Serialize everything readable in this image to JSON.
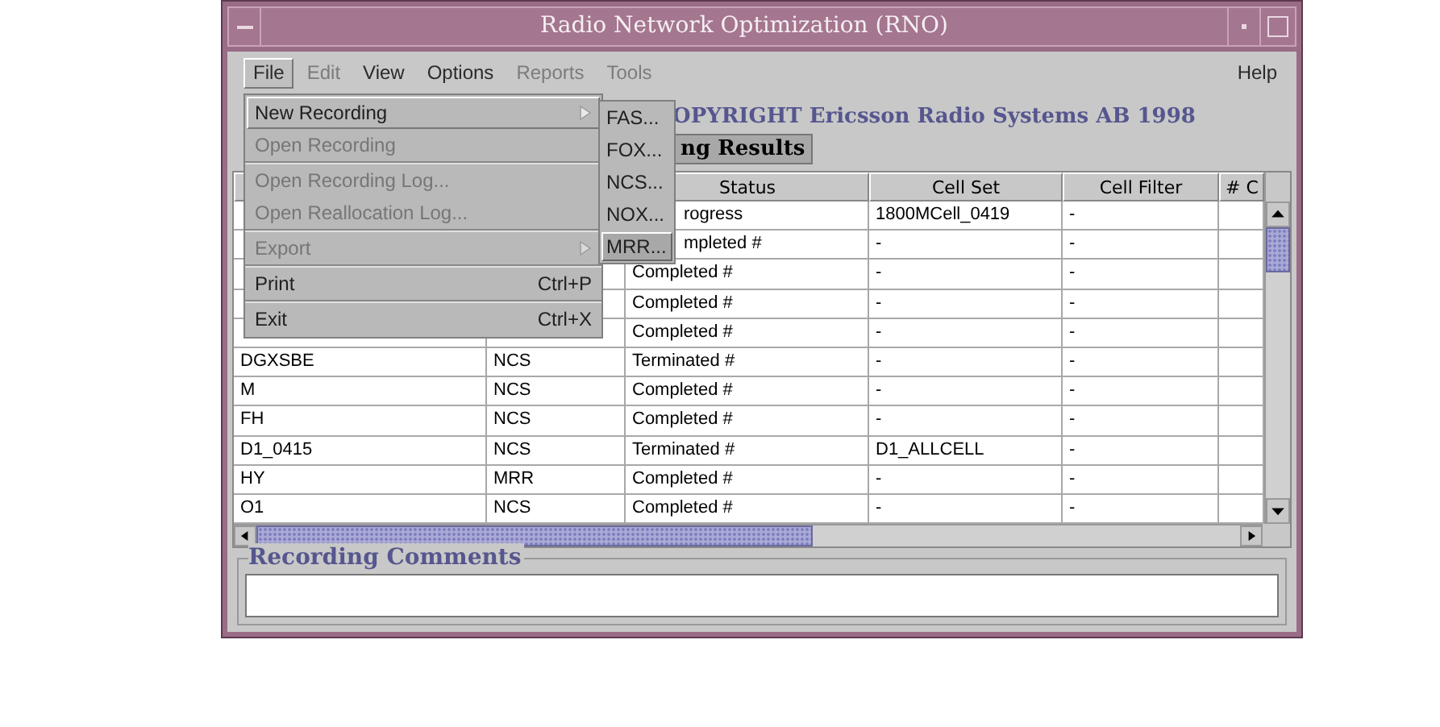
{
  "window": {
    "title": "Radio Network Optimization (RNO)"
  },
  "menubar": [
    {
      "label": "File",
      "selected": true,
      "disabled": false
    },
    {
      "label": "Edit",
      "selected": false,
      "disabled": true
    },
    {
      "label": "View",
      "selected": false,
      "disabled": false
    },
    {
      "label": "Options",
      "selected": false,
      "disabled": false
    },
    {
      "label": "Reports",
      "selected": false,
      "disabled": true
    },
    {
      "label": "Tools",
      "selected": false,
      "disabled": true
    }
  ],
  "help_menu": {
    "label": "Help"
  },
  "file_menu": [
    {
      "label": "New Recording",
      "disabled": false,
      "selected": true,
      "submenu": true
    },
    {
      "label": "Open Recording",
      "disabled": true,
      "selected": false,
      "submenu": false,
      "separator_after": true
    },
    {
      "label": "Open Recording Log...",
      "disabled": true,
      "selected": false,
      "submenu": false
    },
    {
      "label": "Open Reallocation Log...",
      "disabled": true,
      "selected": false,
      "submenu": false,
      "separator_after": true
    },
    {
      "label": "Export",
      "disabled": true,
      "selected": false,
      "submenu": true,
      "separator_after": true
    },
    {
      "label": "Print",
      "shortcut": "Ctrl+P",
      "disabled": false,
      "selected": false,
      "submenu": false,
      "separator_after": true
    },
    {
      "label": "Exit",
      "shortcut": "Ctrl+X",
      "disabled": false,
      "selected": false,
      "submenu": false
    }
  ],
  "new_recording_submenu": [
    {
      "label": "FAS...",
      "selected": false
    },
    {
      "label": "FOX...",
      "selected": false
    },
    {
      "label": "NCS...",
      "selected": false
    },
    {
      "label": "NOX...",
      "selected": false
    },
    {
      "label": "MRR...",
      "selected": true
    }
  ],
  "copyright": "OPYRIGHT Ericsson Radio Systems AB 1998",
  "tabs": [
    {
      "label": "ng Results",
      "selected": true
    }
  ],
  "table": {
    "columns": [
      null,
      null,
      "Status",
      "Cell Set",
      "Cell Filter",
      "# C"
    ],
    "rows": [
      {
        "cells": [
          null,
          null,
          {
            "text": "rogress",
            "clipped": true
          },
          "1800MCell_0419",
          "-",
          ""
        ]
      },
      {
        "cells": [
          null,
          null,
          {
            "text": "mpleted #",
            "clipped": true
          },
          "-",
          "-",
          ""
        ]
      },
      {
        "cells": [
          null,
          "",
          "Completed #",
          "-",
          "-",
          ""
        ]
      },
      {
        "cells": [
          null,
          "",
          "Completed #",
          "-",
          "-",
          ""
        ]
      },
      {
        "cells": [
          null,
          "",
          "Completed #",
          "-",
          "-",
          ""
        ]
      },
      {
        "cells": [
          "DGXSBE",
          "NCS",
          "Terminated #",
          "-",
          "-",
          ""
        ]
      },
      {
        "cells": [
          "M",
          "NCS",
          "Completed #",
          "-",
          "-",
          ""
        ]
      },
      {
        "cells": [
          "FH",
          "NCS",
          "Completed #",
          "-",
          "-",
          ""
        ]
      },
      {
        "cells": [
          "D1_0415",
          "NCS",
          "Terminated #",
          "D1_ALLCELL",
          "-",
          ""
        ]
      },
      {
        "cells": [
          "HY",
          "MRR",
          "Completed #",
          "-",
          "-",
          ""
        ]
      },
      {
        "cells": [
          "O1",
          "NCS",
          "Completed #",
          "-",
          "-",
          ""
        ]
      }
    ]
  },
  "comments": {
    "title": "Recording Comments"
  }
}
